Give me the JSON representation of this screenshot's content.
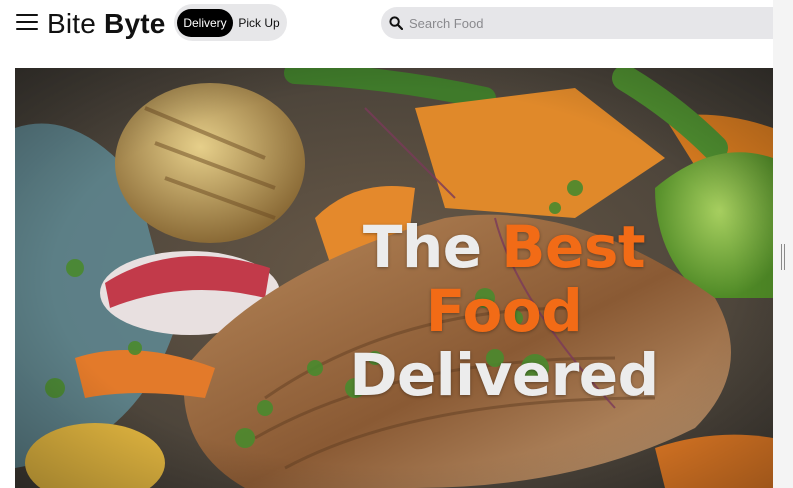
{
  "header": {
    "brand_part1": "Bite",
    "brand_part2": "Byte",
    "menu_icon": "hamburger-menu-icon",
    "order_mode": {
      "options": [
        "Delivery",
        "Pick Up"
      ],
      "selected": "Delivery"
    },
    "search": {
      "placeholder": "Search Food",
      "value": "",
      "icon": "search-icon"
    }
  },
  "hero": {
    "headline_word1": "The",
    "headline_word2": "Best",
    "headline_word3": "Food",
    "headline_word4": "Delivered",
    "accent_color": "#f26b16",
    "text_color": "#ececec"
  }
}
